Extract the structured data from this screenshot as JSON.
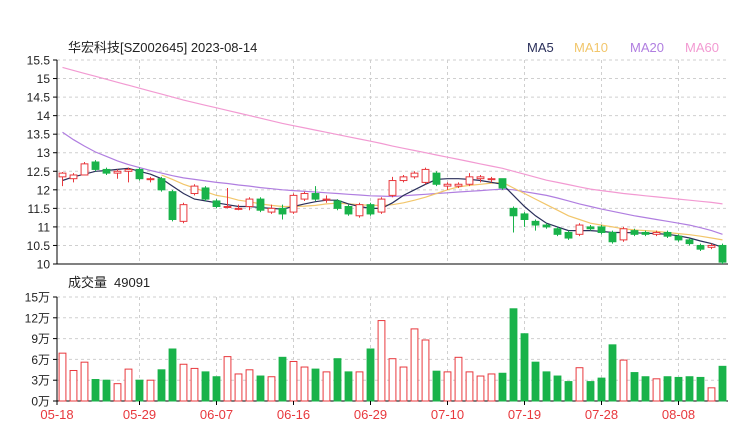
{
  "header": {
    "title": "华宏科技[SZ002645] 2023-08-14",
    "volume_label": "成交量",
    "volume_value": "49091"
  },
  "legend": [
    {
      "name": "MA5",
      "color": "#2a2f5a"
    },
    {
      "name": "MA10",
      "color": "#f2c66b"
    },
    {
      "name": "MA20",
      "color": "#b07ee0"
    },
    {
      "name": "MA60",
      "color": "#f29ad2"
    }
  ],
  "colors": {
    "up": "#e8383d",
    "down": "#19b34a",
    "grid": "#cfcfcf",
    "axis": "#000000"
  },
  "chart_data": [
    {
      "type": "candlestick",
      "ylim": [
        10,
        15.5
      ],
      "yticks": [
        10,
        10.5,
        11,
        11.5,
        12,
        12.5,
        13,
        13.5,
        14,
        14.5,
        15,
        15.5
      ],
      "x_ticks": [
        {
          "index": 0,
          "label": "05-18"
        },
        {
          "index": 7,
          "label": "05-29"
        },
        {
          "index": 14,
          "label": "06-07"
        },
        {
          "index": 21,
          "label": "06-16"
        },
        {
          "index": 28,
          "label": "06-29"
        },
        {
          "index": 35,
          "label": "07-10"
        },
        {
          "index": 42,
          "label": "07-19"
        },
        {
          "index": 49,
          "label": "07-28"
        },
        {
          "index": 56,
          "label": "08-08"
        }
      ],
      "candles": [
        [
          12.35,
          12.45,
          12.1,
          12.48
        ],
        [
          12.3,
          12.4,
          12.2,
          12.45
        ],
        [
          12.4,
          12.7,
          12.4,
          12.75
        ],
        [
          12.75,
          12.55,
          12.5,
          12.8
        ],
        [
          12.55,
          12.45,
          12.4,
          12.6
        ],
        [
          12.45,
          12.5,
          12.3,
          12.55
        ],
        [
          12.5,
          12.55,
          12.2,
          12.6
        ],
        [
          12.55,
          12.3,
          12.25,
          12.6
        ],
        [
          12.3,
          12.3,
          12.2,
          12.35
        ],
        [
          12.3,
          12.0,
          11.95,
          12.35
        ],
        [
          11.95,
          11.2,
          11.15,
          12.0
        ],
        [
          11.15,
          11.6,
          11.1,
          11.65
        ],
        [
          11.9,
          12.1,
          11.85,
          12.15
        ],
        [
          12.05,
          11.75,
          11.7,
          12.1
        ],
        [
          11.7,
          11.55,
          11.5,
          11.75
        ],
        [
          11.55,
          11.55,
          11.5,
          12.05
        ],
        [
          11.5,
          11.5,
          11.45,
          11.6
        ],
        [
          11.55,
          11.75,
          11.45,
          11.8
        ],
        [
          11.75,
          11.45,
          11.4,
          11.8
        ],
        [
          11.4,
          11.5,
          11.35,
          11.6
        ],
        [
          11.5,
          11.35,
          11.2,
          11.6
        ],
        [
          11.4,
          11.85,
          11.35,
          11.9
        ],
        [
          11.75,
          11.9,
          11.7,
          11.95
        ],
        [
          11.9,
          11.75,
          11.7,
          12.1
        ],
        [
          11.75,
          11.75,
          11.65,
          11.85
        ],
        [
          11.7,
          11.5,
          11.45,
          11.75
        ],
        [
          11.55,
          11.35,
          11.3,
          11.6
        ],
        [
          11.3,
          11.6,
          11.25,
          11.65
        ],
        [
          11.6,
          11.35,
          11.3,
          11.65
        ],
        [
          11.4,
          11.75,
          11.35,
          11.8
        ],
        [
          11.85,
          12.25,
          11.8,
          12.35
        ],
        [
          12.25,
          12.35,
          12.2,
          12.4
        ],
        [
          12.35,
          12.45,
          12.3,
          12.5
        ],
        [
          12.2,
          12.55,
          12.15,
          12.6
        ],
        [
          12.45,
          12.15,
          12.1,
          12.5
        ],
        [
          12.1,
          12.15,
          12.0,
          12.2
        ],
        [
          12.1,
          12.15,
          12.05,
          12.2
        ],
        [
          12.15,
          12.35,
          12.1,
          12.45
        ],
        [
          12.3,
          12.35,
          12.2,
          12.4
        ],
        [
          12.3,
          12.3,
          12.2,
          12.35
        ],
        [
          12.3,
          12.05,
          12.0,
          12.3
        ],
        [
          11.5,
          11.3,
          10.85,
          11.55
        ],
        [
          11.35,
          11.2,
          11.0,
          11.4
        ],
        [
          11.15,
          11.05,
          10.9,
          11.2
        ],
        [
          11.05,
          11.0,
          10.95,
          11.1
        ],
        [
          10.95,
          10.8,
          10.75,
          11.0
        ],
        [
          10.85,
          10.7,
          10.65,
          10.9
        ],
        [
          10.8,
          11.05,
          10.75,
          11.1
        ],
        [
          11.0,
          10.95,
          10.9,
          11.05
        ],
        [
          11.0,
          10.85,
          10.8,
          11.05
        ],
        [
          10.85,
          10.6,
          10.55,
          10.9
        ],
        [
          10.65,
          10.95,
          10.6,
          11.0
        ],
        [
          10.9,
          10.8,
          10.75,
          10.95
        ],
        [
          10.85,
          10.8,
          10.75,
          10.9
        ],
        [
          10.8,
          10.85,
          10.75,
          10.9
        ],
        [
          10.85,
          10.75,
          10.7,
          10.9
        ],
        [
          10.75,
          10.65,
          10.6,
          10.8
        ],
        [
          10.65,
          10.55,
          10.5,
          10.7
        ],
        [
          10.5,
          10.4,
          10.35,
          10.55
        ],
        [
          10.45,
          10.5,
          10.4,
          10.55
        ],
        [
          10.5,
          10.05,
          10.0,
          10.55
        ]
      ],
      "ma5": [
        12.25,
        12.35,
        12.42,
        12.5,
        12.52,
        12.55,
        12.58,
        12.5,
        12.42,
        12.3,
        12.1,
        11.9,
        11.75,
        11.7,
        11.65,
        11.6,
        11.55,
        11.55,
        11.52,
        11.5,
        11.48,
        11.55,
        11.62,
        11.68,
        11.72,
        11.72,
        11.62,
        11.55,
        11.5,
        11.5,
        11.65,
        11.85,
        12.0,
        12.15,
        12.28,
        12.3,
        12.3,
        12.28,
        12.25,
        12.2,
        12.15,
        11.85,
        11.55,
        11.3,
        11.1,
        11.0,
        10.9,
        10.9,
        10.9,
        10.88,
        10.85,
        10.85,
        10.84,
        10.83,
        10.82,
        10.8,
        10.76,
        10.7,
        10.62,
        10.55,
        10.45
      ],
      "ma10": [
        null,
        null,
        null,
        null,
        null,
        null,
        null,
        null,
        null,
        12.4,
        12.28,
        12.15,
        12.05,
        11.95,
        11.85,
        11.8,
        11.72,
        11.68,
        11.62,
        11.58,
        11.55,
        11.55,
        11.56,
        11.58,
        11.62,
        11.64,
        11.62,
        11.6,
        11.58,
        11.58,
        11.6,
        11.65,
        11.72,
        11.8,
        11.9,
        12.0,
        12.08,
        12.12,
        12.15,
        12.18,
        12.2,
        12.05,
        11.9,
        11.75,
        11.6,
        11.45,
        11.3,
        11.2,
        11.1,
        11.05,
        11.0,
        10.95,
        10.92,
        10.9,
        10.88,
        10.85,
        10.82,
        10.79,
        10.75,
        10.7,
        10.65
      ],
      "ma20": [
        13.55,
        13.35,
        13.18,
        13.02,
        12.9,
        12.78,
        12.68,
        12.6,
        12.52,
        12.45,
        12.38,
        12.32,
        12.28,
        12.24,
        12.2,
        12.17,
        12.13,
        12.1,
        12.06,
        12.03,
        12.0,
        11.98,
        11.96,
        11.94,
        11.92,
        11.9,
        11.88,
        11.86,
        11.84,
        11.83,
        11.82,
        11.84,
        11.86,
        11.88,
        11.9,
        11.92,
        11.94,
        11.96,
        11.98,
        12.0,
        12.02,
        12.0,
        11.95,
        11.9,
        11.85,
        11.78,
        11.7,
        11.62,
        11.55,
        11.48,
        11.42,
        11.36,
        11.3,
        11.25,
        11.2,
        11.15,
        11.1,
        11.05,
        10.98,
        10.9,
        10.8
      ],
      "ma60": [
        15.3,
        15.22,
        15.14,
        15.06,
        14.98,
        14.9,
        14.82,
        14.74,
        14.66,
        14.58,
        14.5,
        14.42,
        14.35,
        14.28,
        14.21,
        14.14,
        14.07,
        14.0,
        13.93,
        13.86,
        13.79,
        13.73,
        13.67,
        13.61,
        13.55,
        13.49,
        13.43,
        13.37,
        13.31,
        13.25,
        13.18,
        13.12,
        13.06,
        13.0,
        12.94,
        12.88,
        12.82,
        12.76,
        12.7,
        12.64,
        12.58,
        12.5,
        12.42,
        12.34,
        12.26,
        12.2,
        12.14,
        12.08,
        12.02,
        11.98,
        11.94,
        11.9,
        11.87,
        11.84,
        11.81,
        11.78,
        11.75,
        11.72,
        11.69,
        11.66,
        11.62
      ]
    },
    {
      "type": "bar",
      "ylim": [
        0,
        15
      ],
      "ylabels": [
        "0万",
        "3万",
        "6万",
        "9万",
        "12万",
        "15万"
      ],
      "yticks": [
        0,
        3,
        6,
        9,
        12,
        15
      ],
      "unit": "万",
      "volumes": [
        6.9,
        4.4,
        5.6,
        3.1,
        3.0,
        2.5,
        4.6,
        3.0,
        3.0,
        4.5,
        7.5,
        5.3,
        4.7,
        4.2,
        3.5,
        6.4,
        3.9,
        4.5,
        3.6,
        3.5,
        6.3,
        5.7,
        4.9,
        4.6,
        4.2,
        6.1,
        4.2,
        4.2,
        7.5,
        11.6,
        6.1,
        4.9,
        10.4,
        8.8,
        4.3,
        4.2,
        6.3,
        4.2,
        3.6,
        3.9,
        4.0,
        13.3,
        9.7,
        5.6,
        4.2,
        3.6,
        2.8,
        4.8,
        2.8,
        3.3,
        8.1,
        5.9,
        4.1,
        3.5,
        3.2,
        3.5,
        3.4,
        3.5,
        3.4,
        1.9,
        5.0
      ]
    }
  ]
}
